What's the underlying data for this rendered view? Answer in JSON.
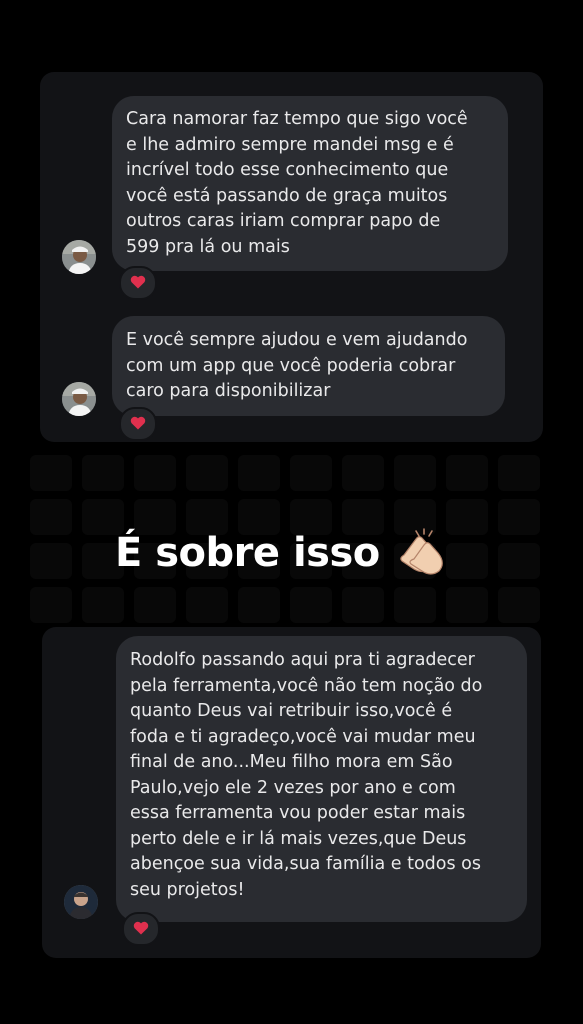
{
  "story": {
    "card1": {
      "messages": [
        {
          "text": "Cara namorar faz tempo que sigo você\ne lhe admiro sempre mandei msg e é\nincrível todo esse conhecimento que\nvocê está passando de graça muitos\noutros caras iriam comprar papo de\n599 pra lá ou mais",
          "reaction": "heart-icon"
        },
        {
          "text": "E você sempre ajudou e vem ajudando\ncom um app que você poderia cobrar\ncaro para disponibilizar",
          "reaction": "heart-icon"
        }
      ]
    },
    "banner": {
      "text": "É sobre isso",
      "icon": "clapping-hands-icon"
    },
    "card2": {
      "messages": [
        {
          "text": "Rodolfo passando aqui pra ti agradecer\npela ferramenta,você não tem noção do\nquanto Deus vai retribuir isso,você é\nfoda e ti agradeço,você vai mudar meu\nfinal de ano...Meu filho mora em São\nPaulo,vejo ele 2 vezes por ano e com\nessa ferramenta vou poder estar mais\nperto dele e ir lá mais vezes,que Deus\nabençoe sua vida,sua família e todos os\nseu projetos!",
          "reaction": "heart-icon"
        }
      ]
    },
    "colors": {
      "background": "#000000",
      "card": "#121316",
      "bubble": "#2a2c31",
      "heart": "#e0304e"
    }
  }
}
